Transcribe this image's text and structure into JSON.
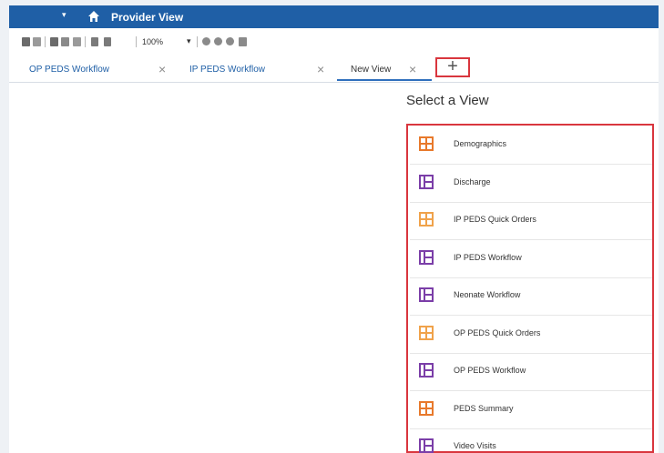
{
  "titlebar": {
    "dropdown": "▾",
    "title": "Provider View"
  },
  "toolbar": {
    "zoom": "100%",
    "zoom_dropdown": "▾"
  },
  "tabs": [
    {
      "label": "OP PEDS Workflow",
      "close": "×"
    },
    {
      "label": "IP PEDS Workflow",
      "close": "×"
    },
    {
      "label": "New View",
      "close": "×"
    }
  ],
  "new_tab": {
    "label": "+"
  },
  "select_view": {
    "title": "Select a View",
    "items": [
      {
        "label": "Demographics",
        "icon": "layout-grid-icon",
        "color": "#e8792b"
      },
      {
        "label": "Discharge",
        "icon": "layout-sidebar-icon",
        "color": "#7b3ea8"
      },
      {
        "label": "IP PEDS Quick Orders",
        "icon": "layout-grid-icon",
        "color": "#f0a24a"
      },
      {
        "label": "IP PEDS Workflow",
        "icon": "layout-sidebar-icon",
        "color": "#7b3ea8"
      },
      {
        "label": "Neonate Workflow",
        "icon": "layout-sidebar-icon",
        "color": "#7b3ea8"
      },
      {
        "label": "OP PEDS Quick Orders",
        "icon": "layout-grid-icon",
        "color": "#f0a24a"
      },
      {
        "label": "OP PEDS Workflow",
        "icon": "layout-sidebar-icon",
        "color": "#7b3ea8"
      },
      {
        "label": "PEDS Summary",
        "icon": "layout-grid-icon",
        "color": "#e8792b"
      },
      {
        "label": "Video Visits",
        "icon": "layout-sidebar-icon",
        "color": "#7b3ea8"
      }
    ]
  },
  "colors": {
    "titlebar": "#1f5fa6",
    "highlight": "#d9363e"
  }
}
